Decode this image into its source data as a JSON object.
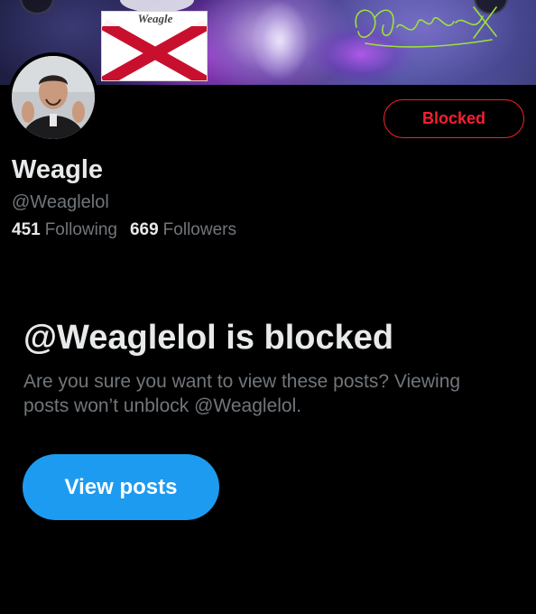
{
  "banner": {
    "flag_label": "Weagle",
    "signature_text": "",
    "icons": [
      "banner-art",
      "alabama-flag-sticker",
      "signature-scribble"
    ]
  },
  "profile": {
    "display_name": "Weagle",
    "handle": "@Weaglelol",
    "following_count": "451",
    "following_label": "Following",
    "followers_count": "669",
    "followers_label": "Followers",
    "block_button_label": "Blocked"
  },
  "blocked_notice": {
    "title": "@Weaglelol is blocked",
    "description": "Are you sure you want to view these posts? Viewing posts won’t unblock @Weaglelol.",
    "view_posts_label": "View posts"
  },
  "colors": {
    "background": "#000000",
    "text_primary": "#e7e9ea",
    "text_secondary": "#71767b",
    "blocked_red": "#f4212e",
    "accent_blue": "#1d9bf0"
  }
}
